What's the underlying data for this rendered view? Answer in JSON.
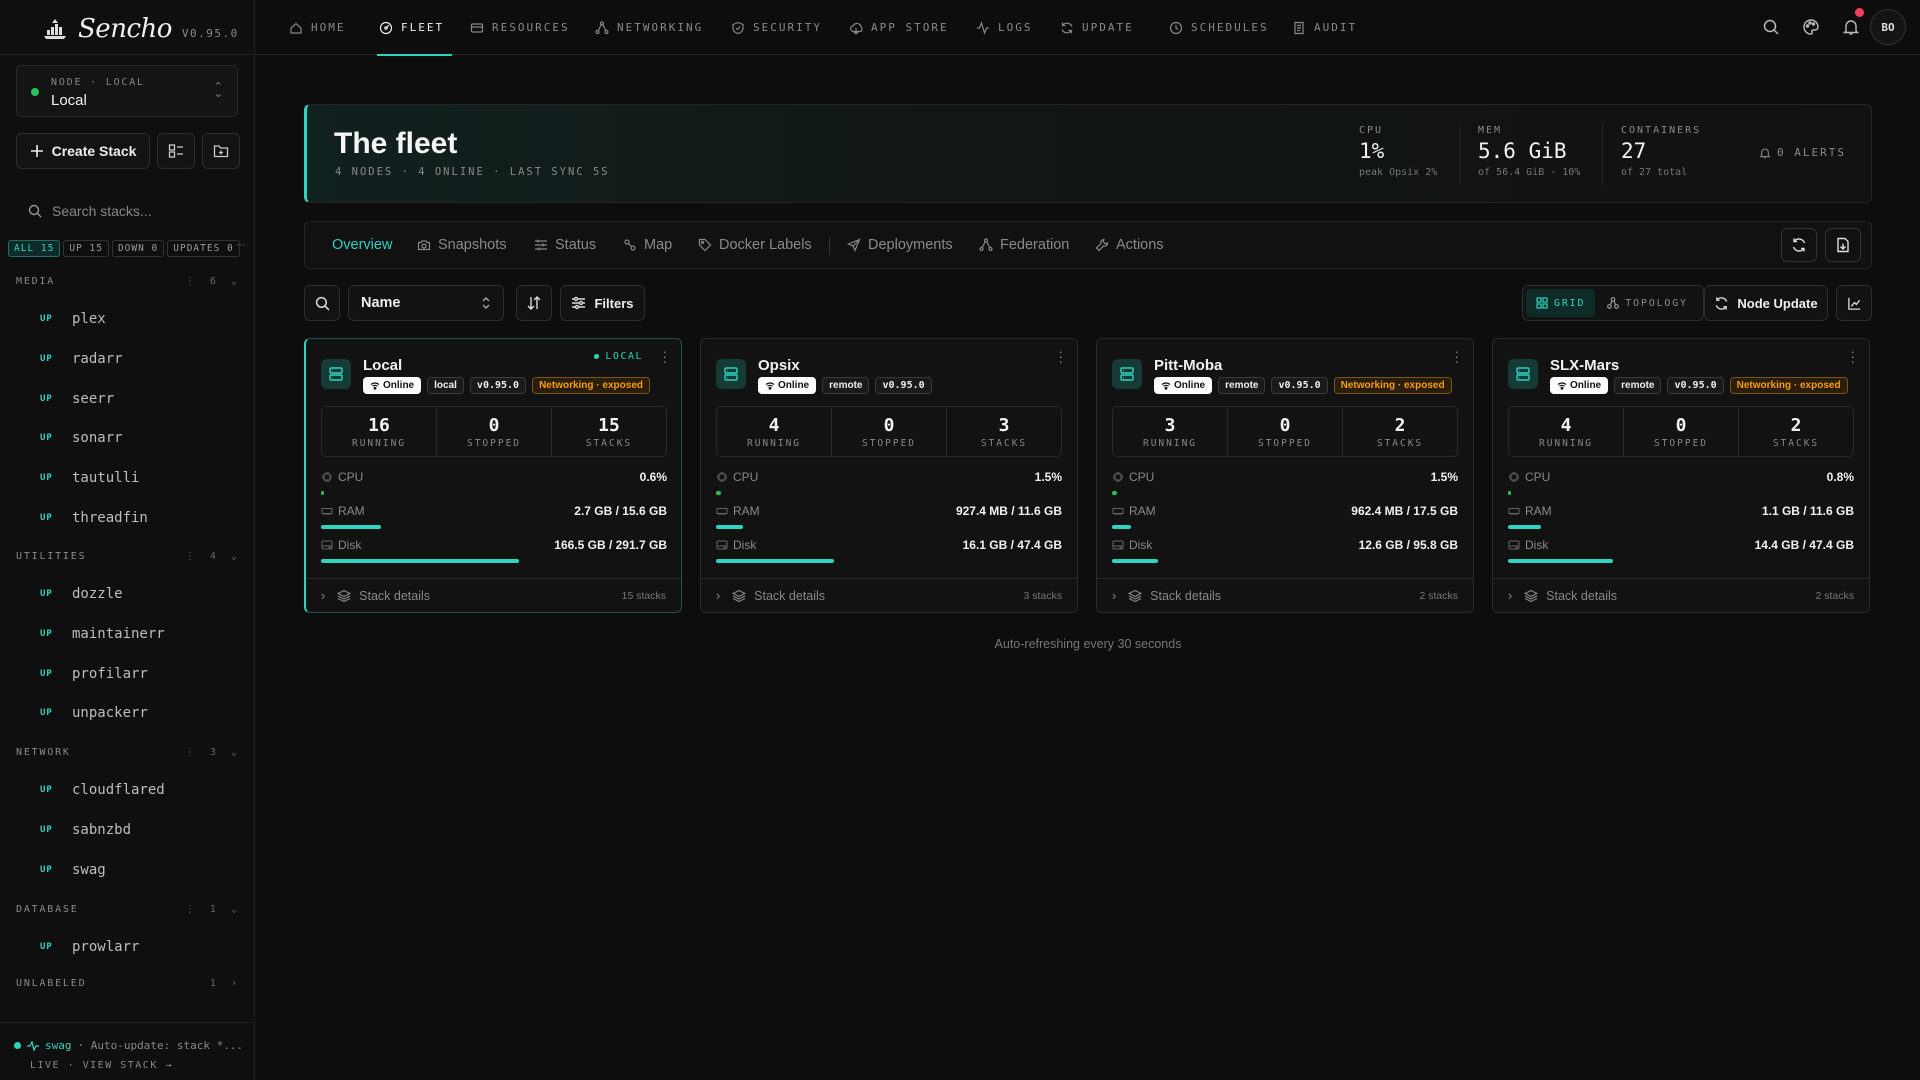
{
  "brand": {
    "name": "Sencho",
    "version": "V0.95.0"
  },
  "node_selector": {
    "label": "NODE · LOCAL",
    "value": "Local"
  },
  "sidebar": {
    "create_label": "Create Stack",
    "search_placeholder": "Search stacks...",
    "filters": [
      "ALL 15",
      "UP 15",
      "DOWN 0",
      "UPDATES 0"
    ],
    "groups": [
      {
        "name": "MEDIA",
        "count": "6",
        "stacks": [
          "plex",
          "radarr",
          "seerr",
          "sonarr",
          "tautulli",
          "threadfin"
        ]
      },
      {
        "name": "UTILITIES",
        "count": "4",
        "stacks": [
          "dozzle",
          "maintainerr",
          "profilarr",
          "unpackerr"
        ]
      },
      {
        "name": "NETWORK",
        "count": "3",
        "stacks": [
          "cloudflared",
          "sabnzbd",
          "swag"
        ]
      },
      {
        "name": "DATABASE",
        "count": "1",
        "stacks": [
          "prowlarr"
        ]
      },
      {
        "name": "UNLABELED",
        "count": "1",
        "stacks": []
      }
    ],
    "status_label": "UP",
    "footer": {
      "stack": "swag",
      "message": "· Auto-update: stack *...",
      "links": "LIVE · VIEW STACK →"
    }
  },
  "nav": [
    "HOME",
    "FLEET",
    "RESOURCES",
    "NETWORKING",
    "SECURITY",
    "APP STORE",
    "LOGS",
    "UPDATE",
    "SCHEDULES",
    "AUDIT"
  ],
  "user_initials": "BO",
  "hero": {
    "title": "The fleet",
    "subtitle": "4 NODES · 4 ONLINE · LAST SYNC 5S",
    "stats": [
      {
        "label": "CPU",
        "value": "1%",
        "sub": "peak Opsix 2%"
      },
      {
        "label": "MEM",
        "value": "5.6 GiB",
        "sub": "of 56.4 GiB · 10%"
      },
      {
        "label": "CONTAINERS",
        "value": "27",
        "sub": "of 27 total"
      }
    ],
    "alerts": "0 ALERTS"
  },
  "tabs": [
    "Overview",
    "Snapshots",
    "Status",
    "Map",
    "Docker Labels",
    "Deployments",
    "Federation",
    "Actions"
  ],
  "toolbar": {
    "sort": "Name",
    "filters": "Filters",
    "grid": "GRID",
    "topology": "TOPOLOGY",
    "node_update": "Node Update"
  },
  "labels": {
    "running": "RUNNING",
    "stopped": "STOPPED",
    "stacks": "STACKS",
    "cpu": "CPU",
    "ram": "RAM",
    "disk": "Disk",
    "stack_details": "Stack details",
    "local_badge": "LOCAL"
  },
  "nodes": [
    {
      "name": "Local",
      "status": "Online",
      "type": "local",
      "version": "v0.95.0",
      "warning": "Networking · exposed",
      "running": "16",
      "stopped": "0",
      "stacks": "15",
      "cpu": "0.6%",
      "cpu_pct": 0.6,
      "ram": "2.7 GB / 15.6 GB",
      "ram_pct": 17.3,
      "disk": "166.5 GB / 291.7 GB",
      "disk_pct": 57.1,
      "stack_count": "15 stacks"
    },
    {
      "name": "Opsix",
      "status": "Online",
      "type": "remote",
      "version": "v0.95.0",
      "warning": "",
      "running": "4",
      "stopped": "0",
      "stacks": "3",
      "cpu": "1.5%",
      "cpu_pct": 1.5,
      "ram": "927.4 MB / 11.6 GB",
      "ram_pct": 7.8,
      "disk": "16.1 GB / 47.4 GB",
      "disk_pct": 34,
      "stack_count": "3 stacks"
    },
    {
      "name": "Pitt-Moba",
      "status": "Online",
      "type": "remote",
      "version": "v0.95.0",
      "warning": "Networking · exposed",
      "running": "3",
      "stopped": "0",
      "stacks": "2",
      "cpu": "1.5%",
      "cpu_pct": 1.5,
      "ram": "962.4 MB / 17.5 GB",
      "ram_pct": 5.4,
      "disk": "12.6 GB / 95.8 GB",
      "disk_pct": 13.2,
      "stack_count": "2 stacks"
    },
    {
      "name": "SLX-Mars",
      "status": "Online",
      "type": "remote",
      "version": "v0.95.0",
      "warning": "Networking · exposed",
      "running": "4",
      "stopped": "0",
      "stacks": "2",
      "cpu": "0.8%",
      "cpu_pct": 0.8,
      "ram": "1.1 GB / 11.6 GB",
      "ram_pct": 9.5,
      "disk": "14.4 GB / 47.4 GB",
      "disk_pct": 30.4,
      "stack_count": "2 stacks"
    }
  ],
  "auto_refresh": "Auto-refreshing every 30 seconds"
}
